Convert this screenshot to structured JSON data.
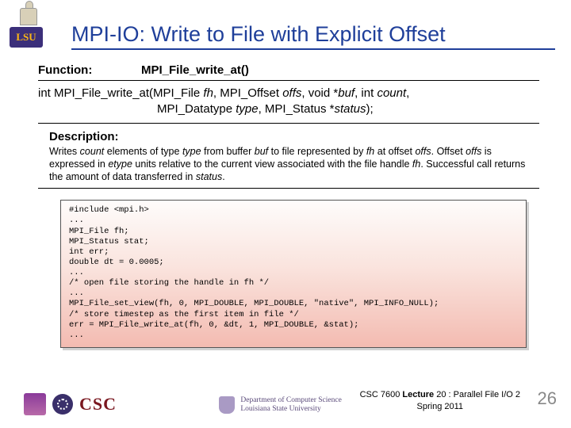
{
  "logo_text": "LSU",
  "title": "MPI-IO: Write to File with Explicit Offset",
  "function": {
    "label": "Function:",
    "name": "MPI_File_write_at()"
  },
  "signature": {
    "line1_html": "int MPI_File_write_at(MPI_File <i>fh</i>, MPI_Offset <i>offs</i>, void *<i>buf</i>, int <i>count</i>,",
    "line2_html": "MPI_Datatype <i>type</i>, MPI_Status *<i>status</i>);"
  },
  "description": {
    "label": "Description:",
    "text_html": "Writes <i>count</i> elements of type <i>type</i> from buffer <i>buf</i> to file represented by <i>fh</i> at offset <i>offs</i>. Offset <i>offs</i> is expressed in <i>etype</i> units relative to the current view associated with the file handle <i>fh</i>. Successful call returns the amount of data transferred in <i>status</i>."
  },
  "code": "#include <mpi.h>\n...\nMPI_File fh;\nMPI_Status stat;\nint err;\ndouble dt = 0.0005;\n...\n/* open file storing the handle in fh */\n...\nMPI_File_set_view(fh, 0, MPI_DOUBLE, MPI_DOUBLE, \"native\", MPI_INFO_NULL);\n/* store timestep as the first item in file */\nerr = MPI_File_write_at(fh, 0, &dt, 1, MPI_DOUBLE, &stat);\n...",
  "footer": {
    "csc": "CSC",
    "dept_line1": "Department of Computer Science",
    "dept_line2": "Louisiana State University",
    "ref_line1_prefix": "CSC 7600 ",
    "ref_line1_bold": "Lecture",
    "ref_line1_suffix": " 20 : Parallel File I/O 2",
    "ref_line2": "Spring 2011",
    "page": "26"
  }
}
